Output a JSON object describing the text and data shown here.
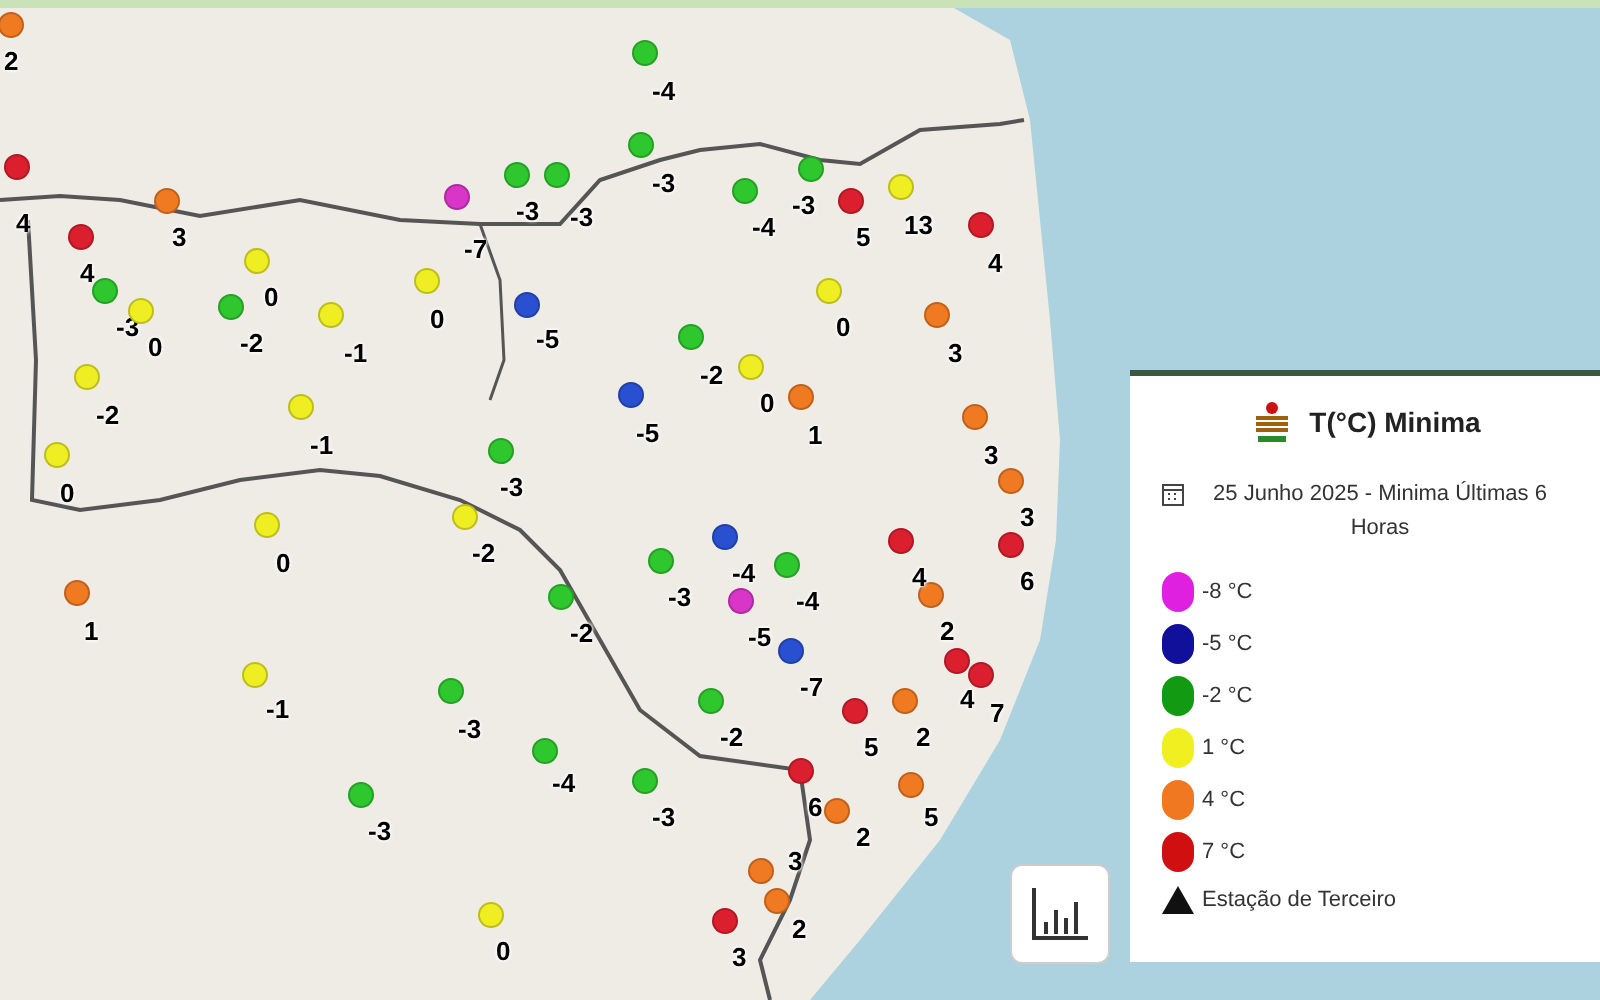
{
  "markers": [
    {
      "value": "4",
      "color": "#dc1f2e"
    },
    {
      "value": "3",
      "color": "#f07a22"
    },
    {
      "value": "4",
      "color": "#dc1f2e"
    },
    {
      "value": "-3",
      "color": "#2ec82e"
    },
    {
      "value": "0",
      "color": "#eeee22"
    },
    {
      "value": "0",
      "color": "#eeee22"
    },
    {
      "value": "-2",
      "color": "#2ec82e"
    },
    {
      "value": "-1",
      "color": "#eeee22"
    },
    {
      "value": "-2",
      "color": "#eeee22"
    },
    {
      "value": "-1",
      "color": "#eeee22"
    },
    {
      "value": "0",
      "color": "#eeee22"
    },
    {
      "value": "-7",
      "color": "#d936c8"
    },
    {
      "value": "0",
      "color": "#eeee22"
    },
    {
      "value": "-3",
      "color": "#2ec82e"
    },
    {
      "value": "-3",
      "color": "#2ec82e"
    },
    {
      "value": "-4",
      "color": "#2ec82e"
    },
    {
      "value": "-3",
      "color": "#2ec82e"
    },
    {
      "value": "-4",
      "color": "#2ec82e"
    },
    {
      "value": "-3",
      "color": "#2ec82e"
    },
    {
      "value": "5",
      "color": "#dc1f2e"
    },
    {
      "value": "13",
      "color": "#eeee22"
    },
    {
      "value": "4",
      "color": "#dc1f2e"
    },
    {
      "value": "0",
      "color": "#eeee22"
    },
    {
      "value": "3",
      "color": "#f07a22"
    },
    {
      "value": "3",
      "color": "#f07a22"
    },
    {
      "value": "0",
      "color": "#eeee22"
    },
    {
      "value": "-2",
      "color": "#2ec82e"
    },
    {
      "value": "1",
      "color": "#f07a22"
    },
    {
      "value": "-5",
      "color": "#2850d0"
    },
    {
      "value": "-5",
      "color": "#2850d0"
    },
    {
      "value": "-3",
      "color": "#2ec82e"
    },
    {
      "value": "0",
      "color": "#eeee22"
    },
    {
      "value": "1",
      "color": "#f07a22"
    },
    {
      "value": "-1",
      "color": "#eeee22"
    },
    {
      "value": "-3",
      "color": "#2ec82e"
    },
    {
      "value": "-4",
      "color": "#2ec82e"
    },
    {
      "value": "-3",
      "color": "#2ec82e"
    },
    {
      "value": "-3",
      "color": "#2ec82e"
    },
    {
      "value": "0",
      "color": "#eeee22"
    },
    {
      "value": "3",
      "color": "#dc1f2e"
    },
    {
      "value": "3",
      "color": "#f07a22"
    },
    {
      "value": "2",
      "color": "#f07a22"
    },
    {
      "value": "6",
      "color": "#dc1f2e"
    },
    {
      "value": "2",
      "color": "#f07a22"
    },
    {
      "value": "5",
      "color": "#dc1f2e"
    },
    {
      "value": "2",
      "color": "#f07a22"
    },
    {
      "value": "5",
      "color": "#f07a22"
    },
    {
      "value": "4",
      "color": "#dc1f2e"
    },
    {
      "value": "7",
      "color": "#dc1f2e"
    },
    {
      "value": "2",
      "color": "#f07a22"
    },
    {
      "value": "4",
      "color": "#dc1f2e"
    },
    {
      "value": "3",
      "color": "#f07a22"
    },
    {
      "value": "6",
      "color": "#dc1f2e"
    },
    {
      "value": "-2",
      "color": "#2ec82e"
    },
    {
      "value": "-3",
      "color": "#2ec82e"
    },
    {
      "value": "-4",
      "color": "#2850d0"
    },
    {
      "value": "-5",
      "color": "#d936c8"
    },
    {
      "value": "-4",
      "color": "#2ec82e"
    },
    {
      "value": "-2",
      "color": "#eeee22"
    },
    {
      "value": "2",
      "color": "#f07a22"
    },
    {
      "value": "-2",
      "color": "#2ec82e"
    },
    {
      "value": "-7",
      "color": "#2850d0"
    }
  ],
  "legend": {
    "title": "T(°C) Minima",
    "date": "25 Junho 2025 - Minima Últimas 6 Horas",
    "items": [
      {
        "label": "-8 °C",
        "color": "#e020e0"
      },
      {
        "label": "-5 °C",
        "color": "#10109a"
      },
      {
        "label": "-2 °C",
        "color": "#139a13"
      },
      {
        "label": "1 °C",
        "color": "#f0f020"
      },
      {
        "label": "4 °C",
        "color": "#f07820"
      },
      {
        "label": "7 °C",
        "color": "#d01010"
      }
    ],
    "station": "Estação de Terceiro"
  }
}
